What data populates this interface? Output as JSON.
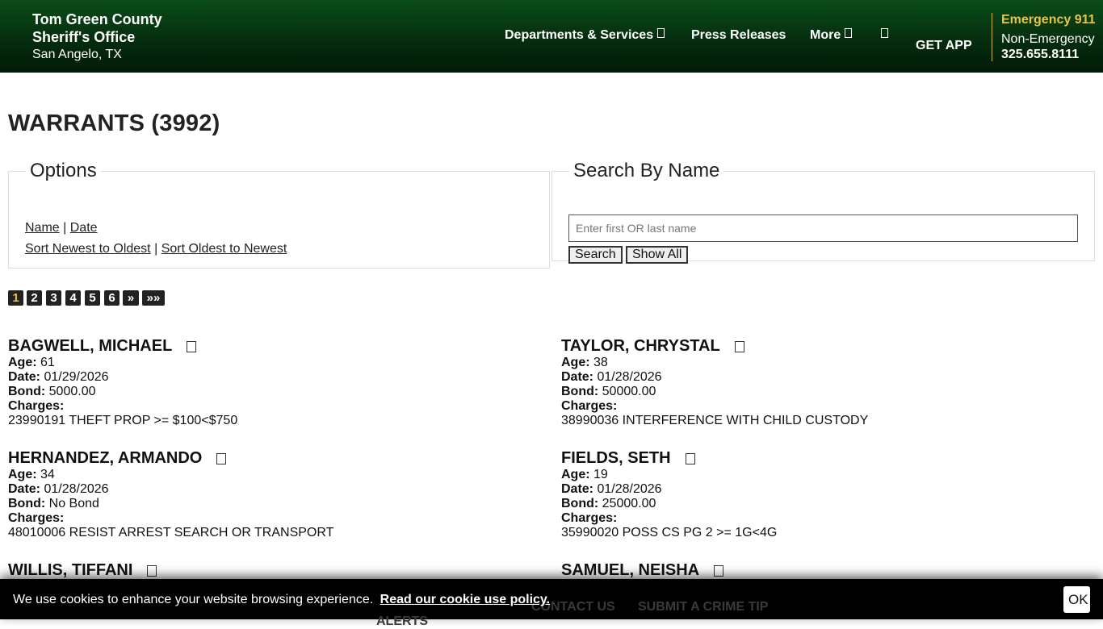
{
  "header": {
    "brand_line1": "Tom Green County",
    "brand_line2": "Sheriff's Office",
    "brand_line3": "San Angelo, TX",
    "nav": {
      "departments": "Departments & Services",
      "press": "Press Releases",
      "more": "More",
      "get_app": "GET APP"
    },
    "emergency_label": "Emergency 911",
    "non_emergency_label": "Non-Emergency",
    "non_emergency_phone": "325.655.8111",
    "accent_color": "#e8c542"
  },
  "page_title": "WARRANTS (3992)",
  "options": {
    "legend": "Options",
    "sort_name": "Name",
    "sort_date": "Date",
    "separator": "|",
    "sort_newest": "Sort Newest to Oldest",
    "sort_oldest": "Sort Oldest to Newest"
  },
  "search": {
    "legend": "Search By Name",
    "placeholder": "Enter first OR last name",
    "value": "",
    "search_button": "Search",
    "show_all_button": "Show All"
  },
  "pagination": {
    "pages": [
      "1",
      "2",
      "3",
      "4",
      "5",
      "6"
    ],
    "next": "»",
    "last": "»»",
    "current": "1"
  },
  "labels": {
    "age": "Age:",
    "date": "Date:",
    "bond": "Bond:",
    "charges": "Charges:"
  },
  "warrants": [
    {
      "name": "BAGWELL, MICHAEL",
      "age": "61",
      "date": "01/29/2026",
      "bond": "5000.00",
      "charges": "23990191 THEFT PROP >= $100<$750"
    },
    {
      "name": "TAYLOR, CHRYSTAL",
      "age": "38",
      "date": "01/28/2026",
      "bond": "50000.00",
      "charges": "38990036 INTERFERENCE WITH CHILD CUSTODY"
    },
    {
      "name": "HERNANDEZ, ARMANDO",
      "age": "34",
      "date": "01/28/2026",
      "bond": "No Bond",
      "charges": "48010006 RESIST ARREST SEARCH OR TRANSPORT"
    },
    {
      "name": "FIELDS, SETH",
      "age": "19",
      "date": "01/28/2026",
      "bond": "25000.00",
      "charges": "35990020 POSS CS PG 2 >= 1G<4G"
    },
    {
      "name": "WILLIS, TIFFANI"
    },
    {
      "name": "SAMUEL, NEISHA"
    }
  ],
  "footer_ghost": {
    "contact": "CONTACT US",
    "crime_tip": "SUBMIT A CRIME TIP",
    "alerts": "ALERTS"
  },
  "cookie": {
    "text": "We use cookies to enhance your website browsing experience.",
    "link": "Read our cookie use policy.",
    "ok": "OK"
  }
}
